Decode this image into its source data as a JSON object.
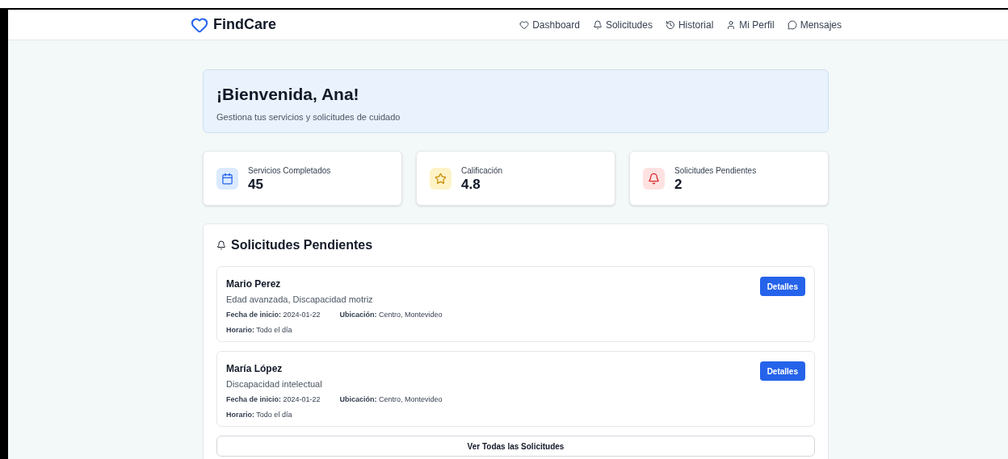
{
  "header": {
    "logo": "FindCare",
    "nav": [
      {
        "label": "Dashboard"
      },
      {
        "label": "Solicitudes"
      },
      {
        "label": "Historial"
      },
      {
        "label": "Mi Perfil"
      },
      {
        "label": "Mensajes"
      }
    ]
  },
  "welcome": {
    "title": "¡Bienvenida, Ana!",
    "subtitle": "Gestiona tus servicios y solicitudes de cuidado"
  },
  "stats": [
    {
      "label": "Servicios Completados",
      "value": "45"
    },
    {
      "label": "Calificación",
      "value": "4.8"
    },
    {
      "label": "Solicitudes Pendientes",
      "value": "2"
    }
  ],
  "pending": {
    "title": "Solicitudes Pendientes",
    "requests": [
      {
        "name": "Mario Perez",
        "needs": "Edad avanzada, Discapacidad motriz",
        "start": "**Fecha de inicio:** 2024-01-22",
        "location": "**Ubicación:** Centro, Montevideo",
        "schedule": "**Horario:** Todo el día",
        "button": "Detalles"
      },
      {
        "name": "María López",
        "needs": "Discapacidad intelectual",
        "start": "**Fecha de inicio:** 2024-01-22",
        "location": "**Ubicación:** Centro, Montevideo",
        "schedule": "**Horario:** Todo el día",
        "button": "Detalles"
      }
    ],
    "view_all": "Ver Todas las Solicitudes"
  }
}
